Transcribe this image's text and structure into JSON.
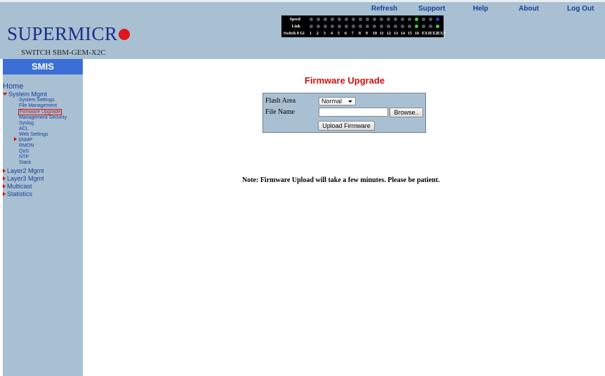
{
  "header": {
    "top_links": [
      "Refresh",
      "Support",
      "Help",
      "About",
      "Log Out"
    ],
    "logo_text": "SUPERMICR",
    "model": "SWITCH SBM-GEM-X2C",
    "brand_color": "#1a2f88",
    "header_bg": "#a8c0d2"
  },
  "port_panel": {
    "speed_label": "Speed",
    "link_label": "Link",
    "port_numbers": [
      "Switch 0 Gi",
      "1",
      "2",
      "3",
      "4",
      "5",
      "6",
      "7",
      "8",
      "9",
      "10",
      "11",
      "12",
      "13",
      "14",
      "15",
      "16",
      "EX1",
      "EX2",
      "EX3"
    ],
    "speed_leds": [
      "off",
      "off",
      "off",
      "off",
      "off",
      "off",
      "off",
      "off",
      "off",
      "off",
      "off",
      "off",
      "off",
      "off",
      "off",
      "green",
      "off",
      "off",
      "blue"
    ],
    "link_leds": [
      "off",
      "off",
      "off",
      "off",
      "off",
      "off",
      "off",
      "off",
      "off",
      "off",
      "off",
      "off",
      "off",
      "off",
      "off",
      "green",
      "off",
      "off",
      "green"
    ]
  },
  "sidebar": {
    "title": "SMIS",
    "home": "Home",
    "system_mgmt": "System Mgmt",
    "system_items": [
      "System Settings",
      "File Management",
      "Firmware Upgrade",
      "Management Security",
      "Syslog",
      "ACL",
      "Web Settings",
      "SNMP",
      "RMON",
      "QoS",
      "NTP",
      "Stack"
    ],
    "active_item": "Firmware Upgrade",
    "other_sections": [
      "Layer2 Mgmt",
      "Layer3 Mgmt",
      "Multicast",
      "Statistics"
    ]
  },
  "main": {
    "title": "Firmware Upgrade",
    "flash_area_label": "Flash Area",
    "flash_area_value": "Normal",
    "file_name_label": "File Name",
    "file_name_value": "",
    "browse_label": "Browse..",
    "upload_label": "Upload Firmware",
    "note": "Note: Firmware Upload will take a few minutes. Please be patient."
  },
  "colors": {
    "title_red": "#d01010",
    "link_blue": "#1a3f9b",
    "smis_bar": "#3b6fd6",
    "led_green": "#3bd53b",
    "led_blue": "#2d3ed8",
    "led_off": "#555b66"
  }
}
